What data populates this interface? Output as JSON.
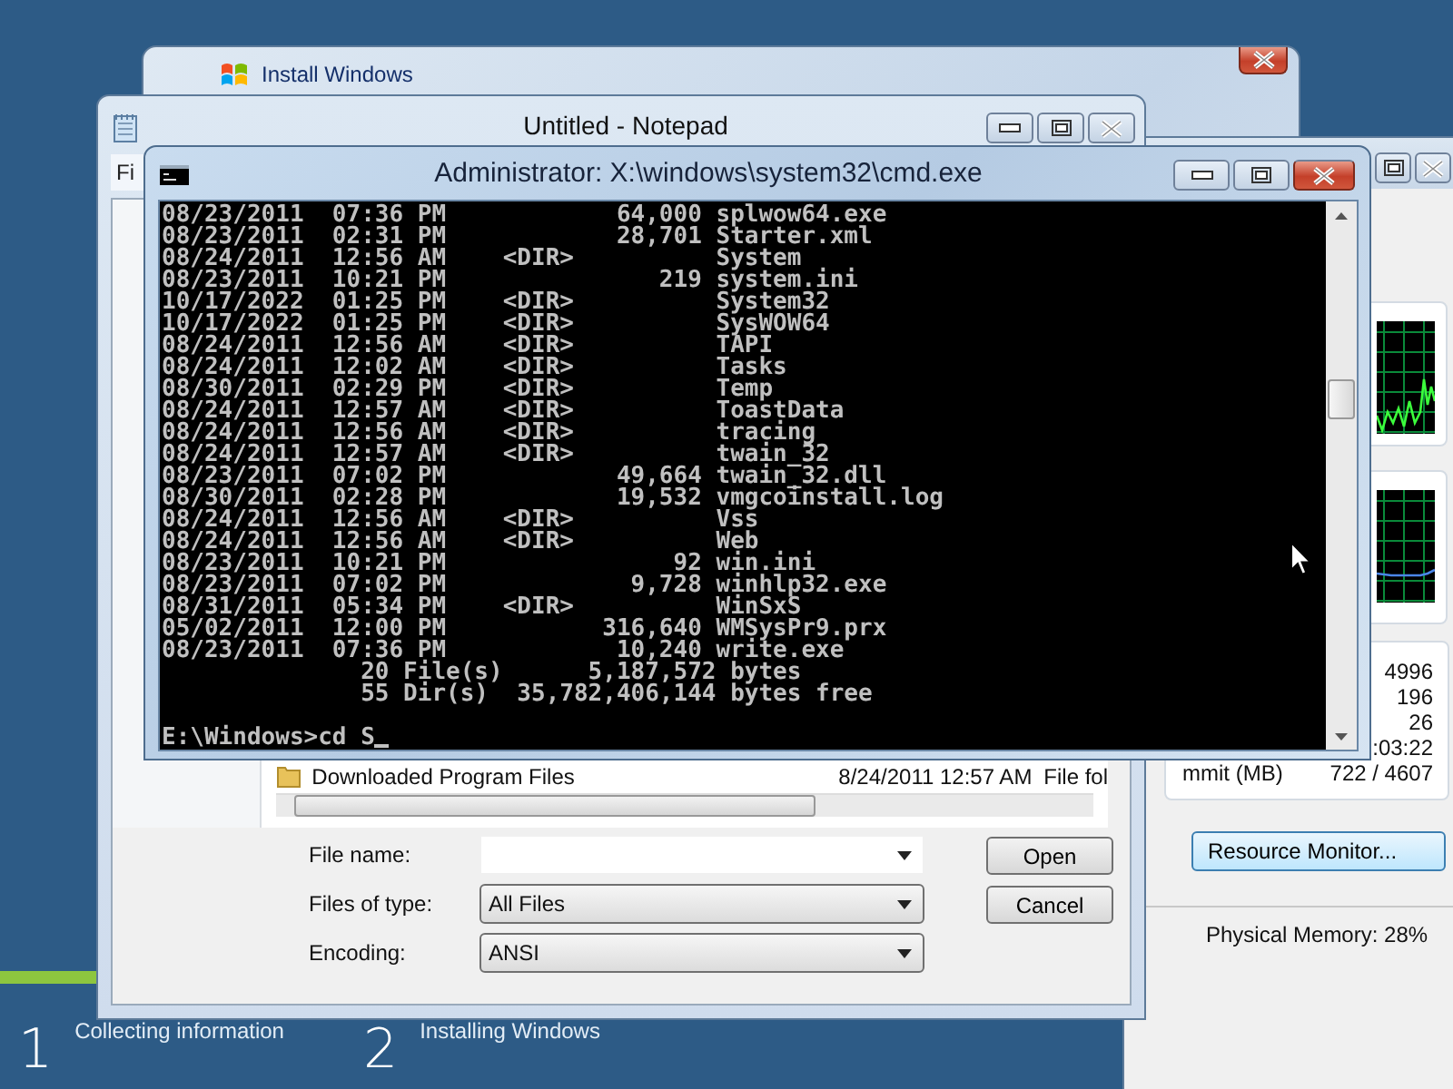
{
  "install_window": {
    "title": "Install Windows"
  },
  "task_manager": {
    "stats": [
      {
        "value": "4996"
      },
      {
        "value": "196"
      },
      {
        "value": "26"
      },
      {
        "value": ":03:22"
      },
      {
        "label": "mmit (MB)",
        "value": "722 / 4607"
      }
    ],
    "button": "Resource Monitor...",
    "status": "Physical Memory: 28%"
  },
  "notepad": {
    "title": "Untitled - Notepad",
    "menu": [
      "Fi"
    ],
    "open_dialog": {
      "file": {
        "name": "Downloaded Program Files",
        "date": "8/24/2011 12:57 AM",
        "type": "File fol"
      },
      "fields": [
        {
          "kind": "input",
          "label": "File name:"
        },
        {
          "kind": "dropdown",
          "label": "Files of type:",
          "value": "All Files"
        },
        {
          "kind": "dropdown",
          "label": "Encoding:",
          "value": "ANSI"
        }
      ],
      "buttons": [
        "Open",
        "Cancel"
      ]
    }
  },
  "cmd": {
    "title": "Administrator: X:\\windows\\system32\\cmd.exe",
    "lines": [
      "08/23/2011  07:36 PM            64,000 splwow64.exe",
      "08/23/2011  02:31 PM            28,701 Starter.xml",
      "08/24/2011  12:56 AM    <DIR>          System",
      "08/23/2011  10:21 PM               219 system.ini",
      "10/17/2022  01:25 PM    <DIR>          System32",
      "10/17/2022  01:25 PM    <DIR>          SysWOW64",
      "08/24/2011  12:56 AM    <DIR>          TAPI",
      "08/24/2011  12:02 AM    <DIR>          Tasks",
      "08/30/2011  02:29 PM    <DIR>          Temp",
      "08/24/2011  12:57 AM    <DIR>          ToastData",
      "08/24/2011  12:56 AM    <DIR>          tracing",
      "08/24/2011  12:57 AM    <DIR>          twain_32",
      "08/23/2011  07:02 PM            49,664 twain_32.dll",
      "08/30/2011  02:28 PM            19,532 vmgcoinstall.log",
      "08/24/2011  12:56 AM    <DIR>          Vss",
      "08/24/2011  12:56 AM    <DIR>          Web",
      "08/23/2011  10:21 PM                92 win.ini",
      "08/23/2011  07:02 PM             9,728 winhlp32.exe",
      "08/31/2011  05:34 PM    <DIR>          WinSxS",
      "05/02/2011  12:00 PM           316,640 WMSysPr9.prx",
      "08/23/2011  07:36 PM            10,240 write.exe",
      "              20 File(s)      5,187,572 bytes",
      "              55 Dir(s)  35,782,406,144 bytes free"
    ],
    "prompt": "E:\\Windows>cd S"
  },
  "setup": {
    "progress": {
      "level": 0.07
    },
    "steps": [
      {
        "number": "1",
        "label": "Collecting information"
      },
      {
        "number": "2",
        "label": "Installing Windows"
      }
    ]
  }
}
